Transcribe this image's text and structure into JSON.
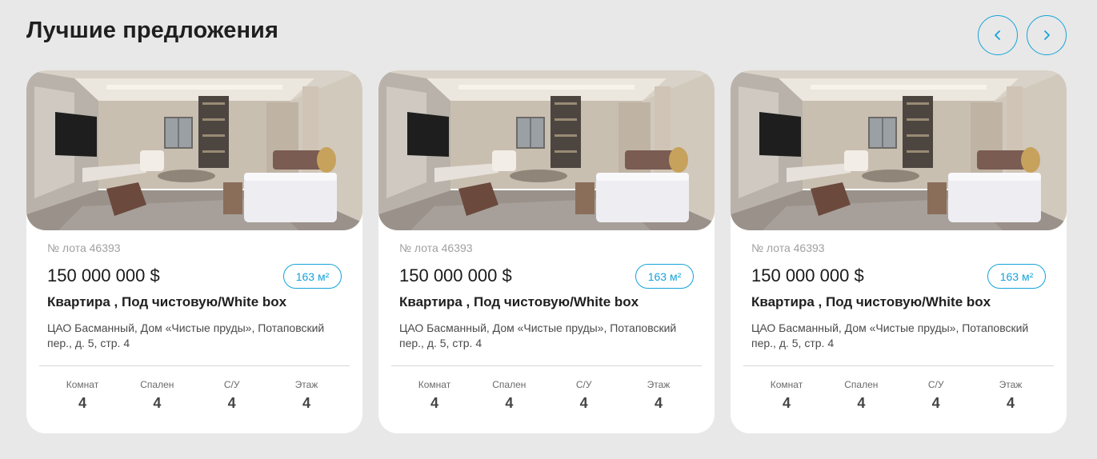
{
  "section": {
    "title": "Лучшие предложения"
  },
  "nav": {
    "prev_icon": "chevron-left-icon",
    "next_icon": "chevron-right-icon",
    "accent_color": "#16a3d9"
  },
  "cards": [
    {
      "lot": "№ лота 46393",
      "price": "150 000 000 $",
      "area": "163 м²",
      "type": "Квартира , Под чистовую/White box",
      "address": "ЦАО Басманный, Дом «Чистые пруды», Потаповский пер., д. 5, стр. 4",
      "stats": [
        {
          "label": "Комнат",
          "value": "4"
        },
        {
          "label": "Спален",
          "value": "4"
        },
        {
          "label": "С/У",
          "value": "4"
        },
        {
          "label": "Этаж",
          "value": "4"
        }
      ]
    },
    {
      "lot": "№ лота 46393",
      "price": "150 000 000 $",
      "area": "163 м²",
      "type": "Квартира , Под чистовую/White box",
      "address": "ЦАО Басманный, Дом «Чистые пруды», Потаповский пер., д. 5, стр. 4",
      "stats": [
        {
          "label": "Комнат",
          "value": "4"
        },
        {
          "label": "Спален",
          "value": "4"
        },
        {
          "label": "С/У",
          "value": "4"
        },
        {
          "label": "Этаж",
          "value": "4"
        }
      ]
    },
    {
      "lot": "№ лота 46393",
      "price": "150 000 000 $",
      "area": "163 м²",
      "type": "Квартира , Под чистовую/White box",
      "address": "ЦАО Басманный, Дом «Чистые пруды», Потаповский пер., д. 5, стр. 4",
      "stats": [
        {
          "label": "Комнат",
          "value": "4"
        },
        {
          "label": "Спален",
          "value": "4"
        },
        {
          "label": "С/У",
          "value": "4"
        },
        {
          "label": "Этаж",
          "value": "4"
        }
      ]
    }
  ]
}
